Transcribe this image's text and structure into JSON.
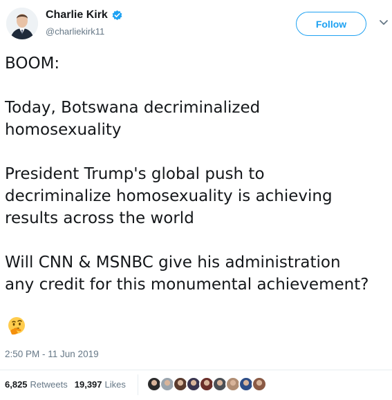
{
  "author": {
    "display_name": "Charlie Kirk",
    "handle": "@charliekirk11",
    "verified": true
  },
  "follow_button": {
    "label": "Follow"
  },
  "menu": {
    "icon": "chevron-down-icon"
  },
  "tweet": {
    "lines": [
      "BOOM:",
      "",
      "Today, Botswana decriminalized",
      "homosexuality",
      "",
      "President Trump's global push to",
      "decriminalize homosexuality is achieving",
      "results across the world",
      "",
      "Will CNN & MSNBC give his administration",
      "any credit for this monumental achievement?"
    ],
    "emoji": "thinking-face-icon"
  },
  "timestamp": "2:50 PM - 11 Jun 2019",
  "stats": {
    "retweets_count": "6,825",
    "retweets_label": "Retweets",
    "likes_count": "19,397",
    "likes_label": "Likes"
  },
  "likers": [
    {
      "name": "liker-avatar-1",
      "color": "#2b2b2b"
    },
    {
      "name": "liker-avatar-2",
      "color": "#9aa4ad"
    },
    {
      "name": "liker-avatar-3",
      "color": "#5a3b2e"
    },
    {
      "name": "liker-avatar-4",
      "color": "#3a3550"
    },
    {
      "name": "liker-avatar-5",
      "color": "#6b2f2a"
    },
    {
      "name": "liker-avatar-6",
      "color": "#4b4f55"
    },
    {
      "name": "liker-avatar-7",
      "color": "#b08d73"
    },
    {
      "name": "liker-avatar-8",
      "color": "#2d4d86"
    },
    {
      "name": "liker-avatar-9",
      "color": "#8a5a45"
    }
  ],
  "colors": {
    "accent": "#1da1f2",
    "secondary_text": "#657786",
    "primary_text": "#14171a"
  }
}
